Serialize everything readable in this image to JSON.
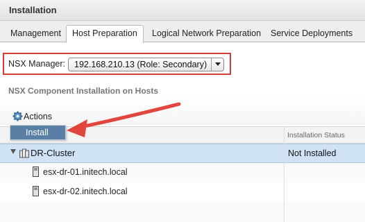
{
  "window": {
    "title": "Installation"
  },
  "tabs": [
    {
      "label": "Management",
      "active": false
    },
    {
      "label": "Host Preparation",
      "active": true
    },
    {
      "label": "Logical Network Preparation",
      "active": false
    },
    {
      "label": "Service Deployments",
      "active": false
    }
  ],
  "nsx_manager": {
    "label": "NSX Manager:",
    "selected": "192.168.210.13 (Role: Secondary)"
  },
  "section": {
    "title": "NSX Component Installation on Hosts"
  },
  "actions": {
    "label": "Actions",
    "icon": "gear-icon"
  },
  "context_menu": {
    "install_label": "Install"
  },
  "grid": {
    "columns": {
      "status": "Installation Status"
    },
    "cluster": {
      "name": "DR-Cluster",
      "status": "Not Installed"
    },
    "hosts": [
      {
        "name": "esx-dr-01.initech.local"
      },
      {
        "name": "esx-dr-02.initech.local"
      }
    ]
  },
  "colors": {
    "highlight_border": "#d43b35",
    "selected_row": "#cfe3f5",
    "menu_item": "#5a7fa5",
    "annotation_arrow": "#e0463d"
  }
}
